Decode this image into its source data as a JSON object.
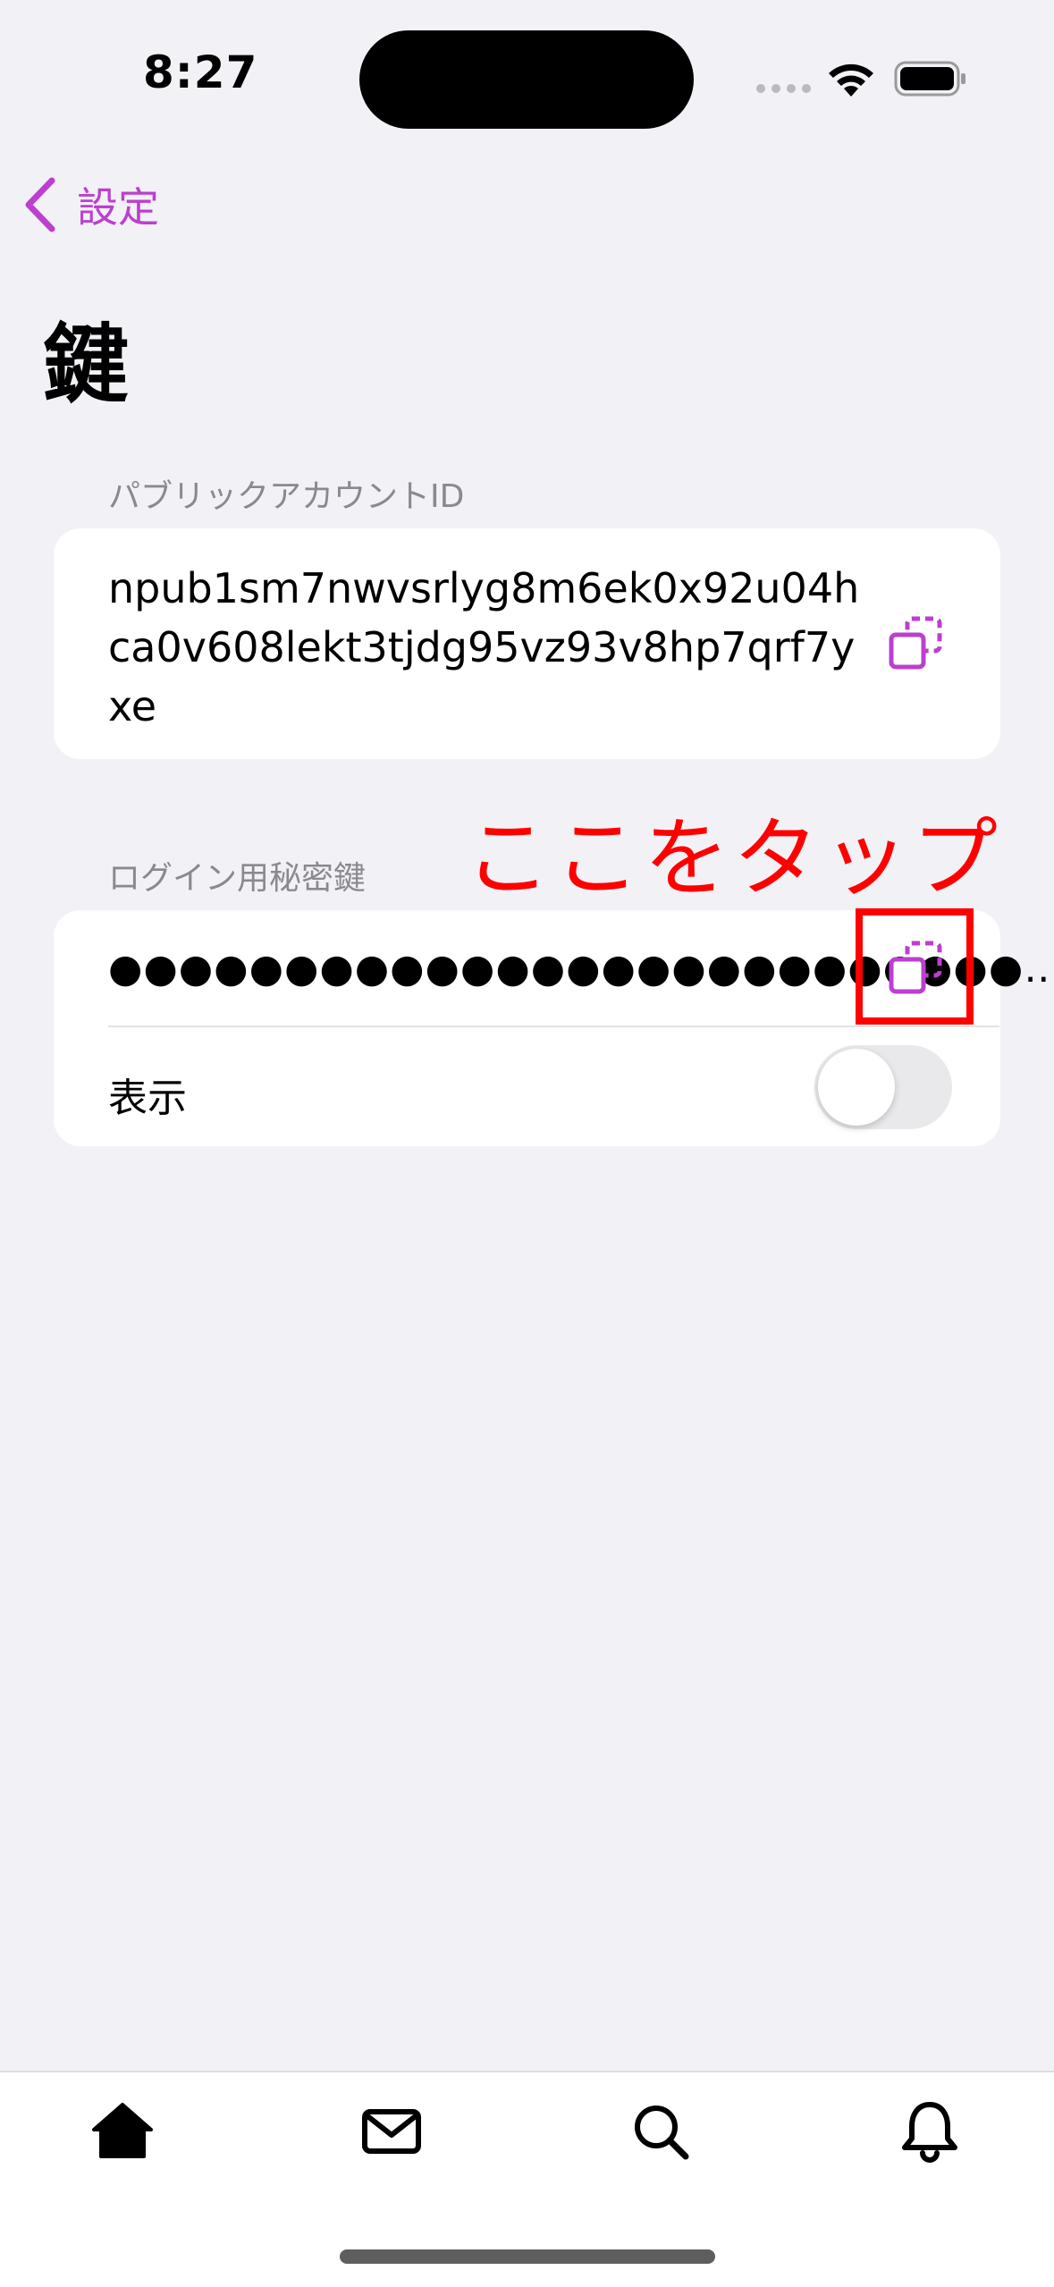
{
  "status_bar": {
    "time": "8:27"
  },
  "nav": {
    "back_label": "設定",
    "title": "鍵"
  },
  "public_id": {
    "label": "パブリックアカウントID",
    "value": "npub1sm7nwvsrlyg8m6ek0x92u04hca0v608lekt3tjdg95vz93v8hp7qrf7yxe"
  },
  "secret_key": {
    "label": "ログイン用秘密鍵",
    "masked_value": "●●●●●●●●●●●●●●●●●●●●●●●●●●…",
    "show_label": "表示",
    "show_toggle_on": false
  },
  "annotation": {
    "text": "ここをタップ"
  },
  "colors": {
    "accent": "#bc3fcf",
    "annotation": "#ff0000",
    "background": "#f2f1f6"
  },
  "tabs": [
    {
      "icon": "home-icon"
    },
    {
      "icon": "mail-icon"
    },
    {
      "icon": "search-icon"
    },
    {
      "icon": "bell-icon"
    }
  ]
}
